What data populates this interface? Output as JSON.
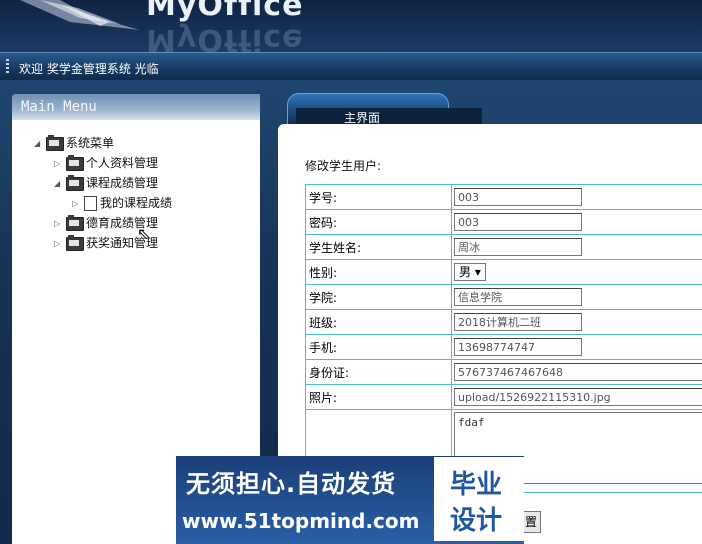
{
  "header": {
    "brand": "MyOffice",
    "welcome": "欢迎 奖学金管理系统 光临"
  },
  "menu": {
    "title": "Main Menu",
    "root": "系统菜单",
    "items": [
      {
        "label": "个人资料管理"
      },
      {
        "label": "课程成绩管理",
        "children": [
          {
            "label": "我的课程成绩"
          }
        ]
      },
      {
        "label": "德育成绩管理"
      },
      {
        "label": "获奖通知管理"
      }
    ]
  },
  "tab": {
    "label": "主界面"
  },
  "form": {
    "title": "修改学生用户:",
    "fields": {
      "student_id": {
        "label": "学号:",
        "value": "003"
      },
      "password": {
        "label": "密码:",
        "value": "003"
      },
      "name": {
        "label": "学生姓名:",
        "value": "周冰"
      },
      "gender": {
        "label": "性别:",
        "value": "男 ▾"
      },
      "college": {
        "label": "学院:",
        "value": "信息学院"
      },
      "class": {
        "label": "班级:",
        "value": "2018计算机二班"
      },
      "phone": {
        "label": "手机:",
        "value": "13698774747"
      },
      "id_card": {
        "label": "身份证:",
        "value": "576737467467648"
      },
      "photo": {
        "label": "照片:",
        "value": "upload/1526922115310.jpg"
      },
      "remark": {
        "label": "",
        "value": "fdaf"
      }
    },
    "submit_label": "置"
  },
  "watermark": {
    "slogan": "无须担心.自动发货",
    "url": "www.51topmind.com",
    "badge_line1": "毕业",
    "badge_line2": "设计"
  }
}
